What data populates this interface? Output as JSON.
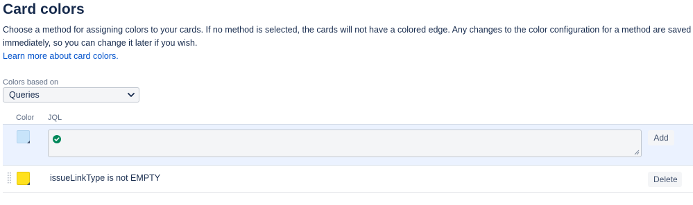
{
  "page": {
    "title": "Card colors",
    "description": "Choose a method for assigning colors to your cards. If no method is selected, the cards will not have a colored edge. Any changes to the color configuration for a method are saved immediately, so you can change it later if you wish.",
    "learn_more_link": "Learn more about card colors."
  },
  "method": {
    "label": "Colors based on",
    "selected": "Queries"
  },
  "table": {
    "headers": {
      "color": "Color",
      "jql": "JQL"
    },
    "new_row": {
      "swatch_color": "#c8e4fa",
      "jql_value": "",
      "add_label": "Add",
      "valid_icon": "check-circle-icon"
    },
    "rules": [
      {
        "swatch_color": "#ffe11f",
        "jql": "issueLinkType is not EMPTY",
        "delete_label": "Delete"
      }
    ]
  }
}
